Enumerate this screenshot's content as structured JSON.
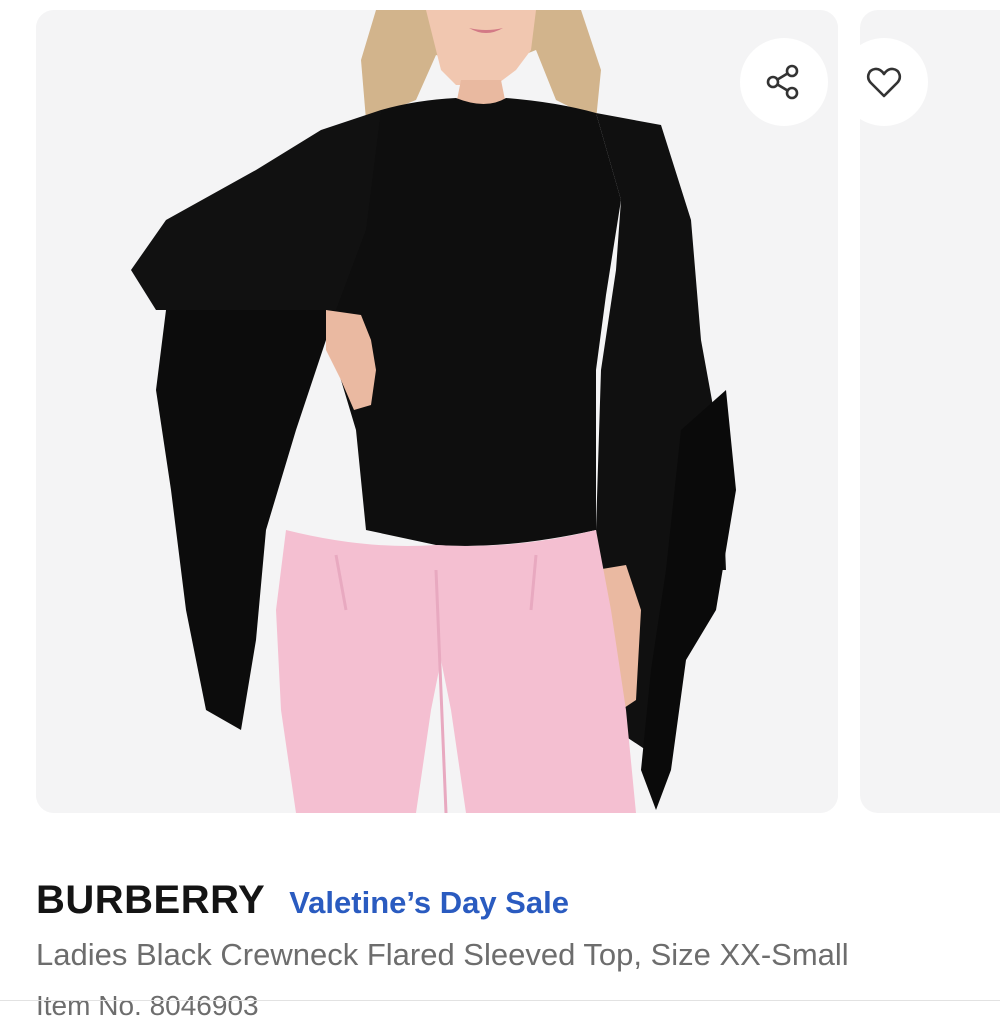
{
  "product": {
    "brand": "BURBERRY",
    "promo_label": "Valetine’s Day Sale",
    "name": "Ladies Black Crewneck Flared Sleeved Top, Size XX-Small",
    "item_number": "Item No. 8046903"
  },
  "gallery": {
    "share_icon": "share-icon",
    "favorite_icon": "heart-icon"
  },
  "colors": {
    "brand_text": "#141414",
    "promo_text": "#2a5bc0",
    "secondary_text": "#6d6d6d",
    "card_background": "#f4f4f5"
  }
}
